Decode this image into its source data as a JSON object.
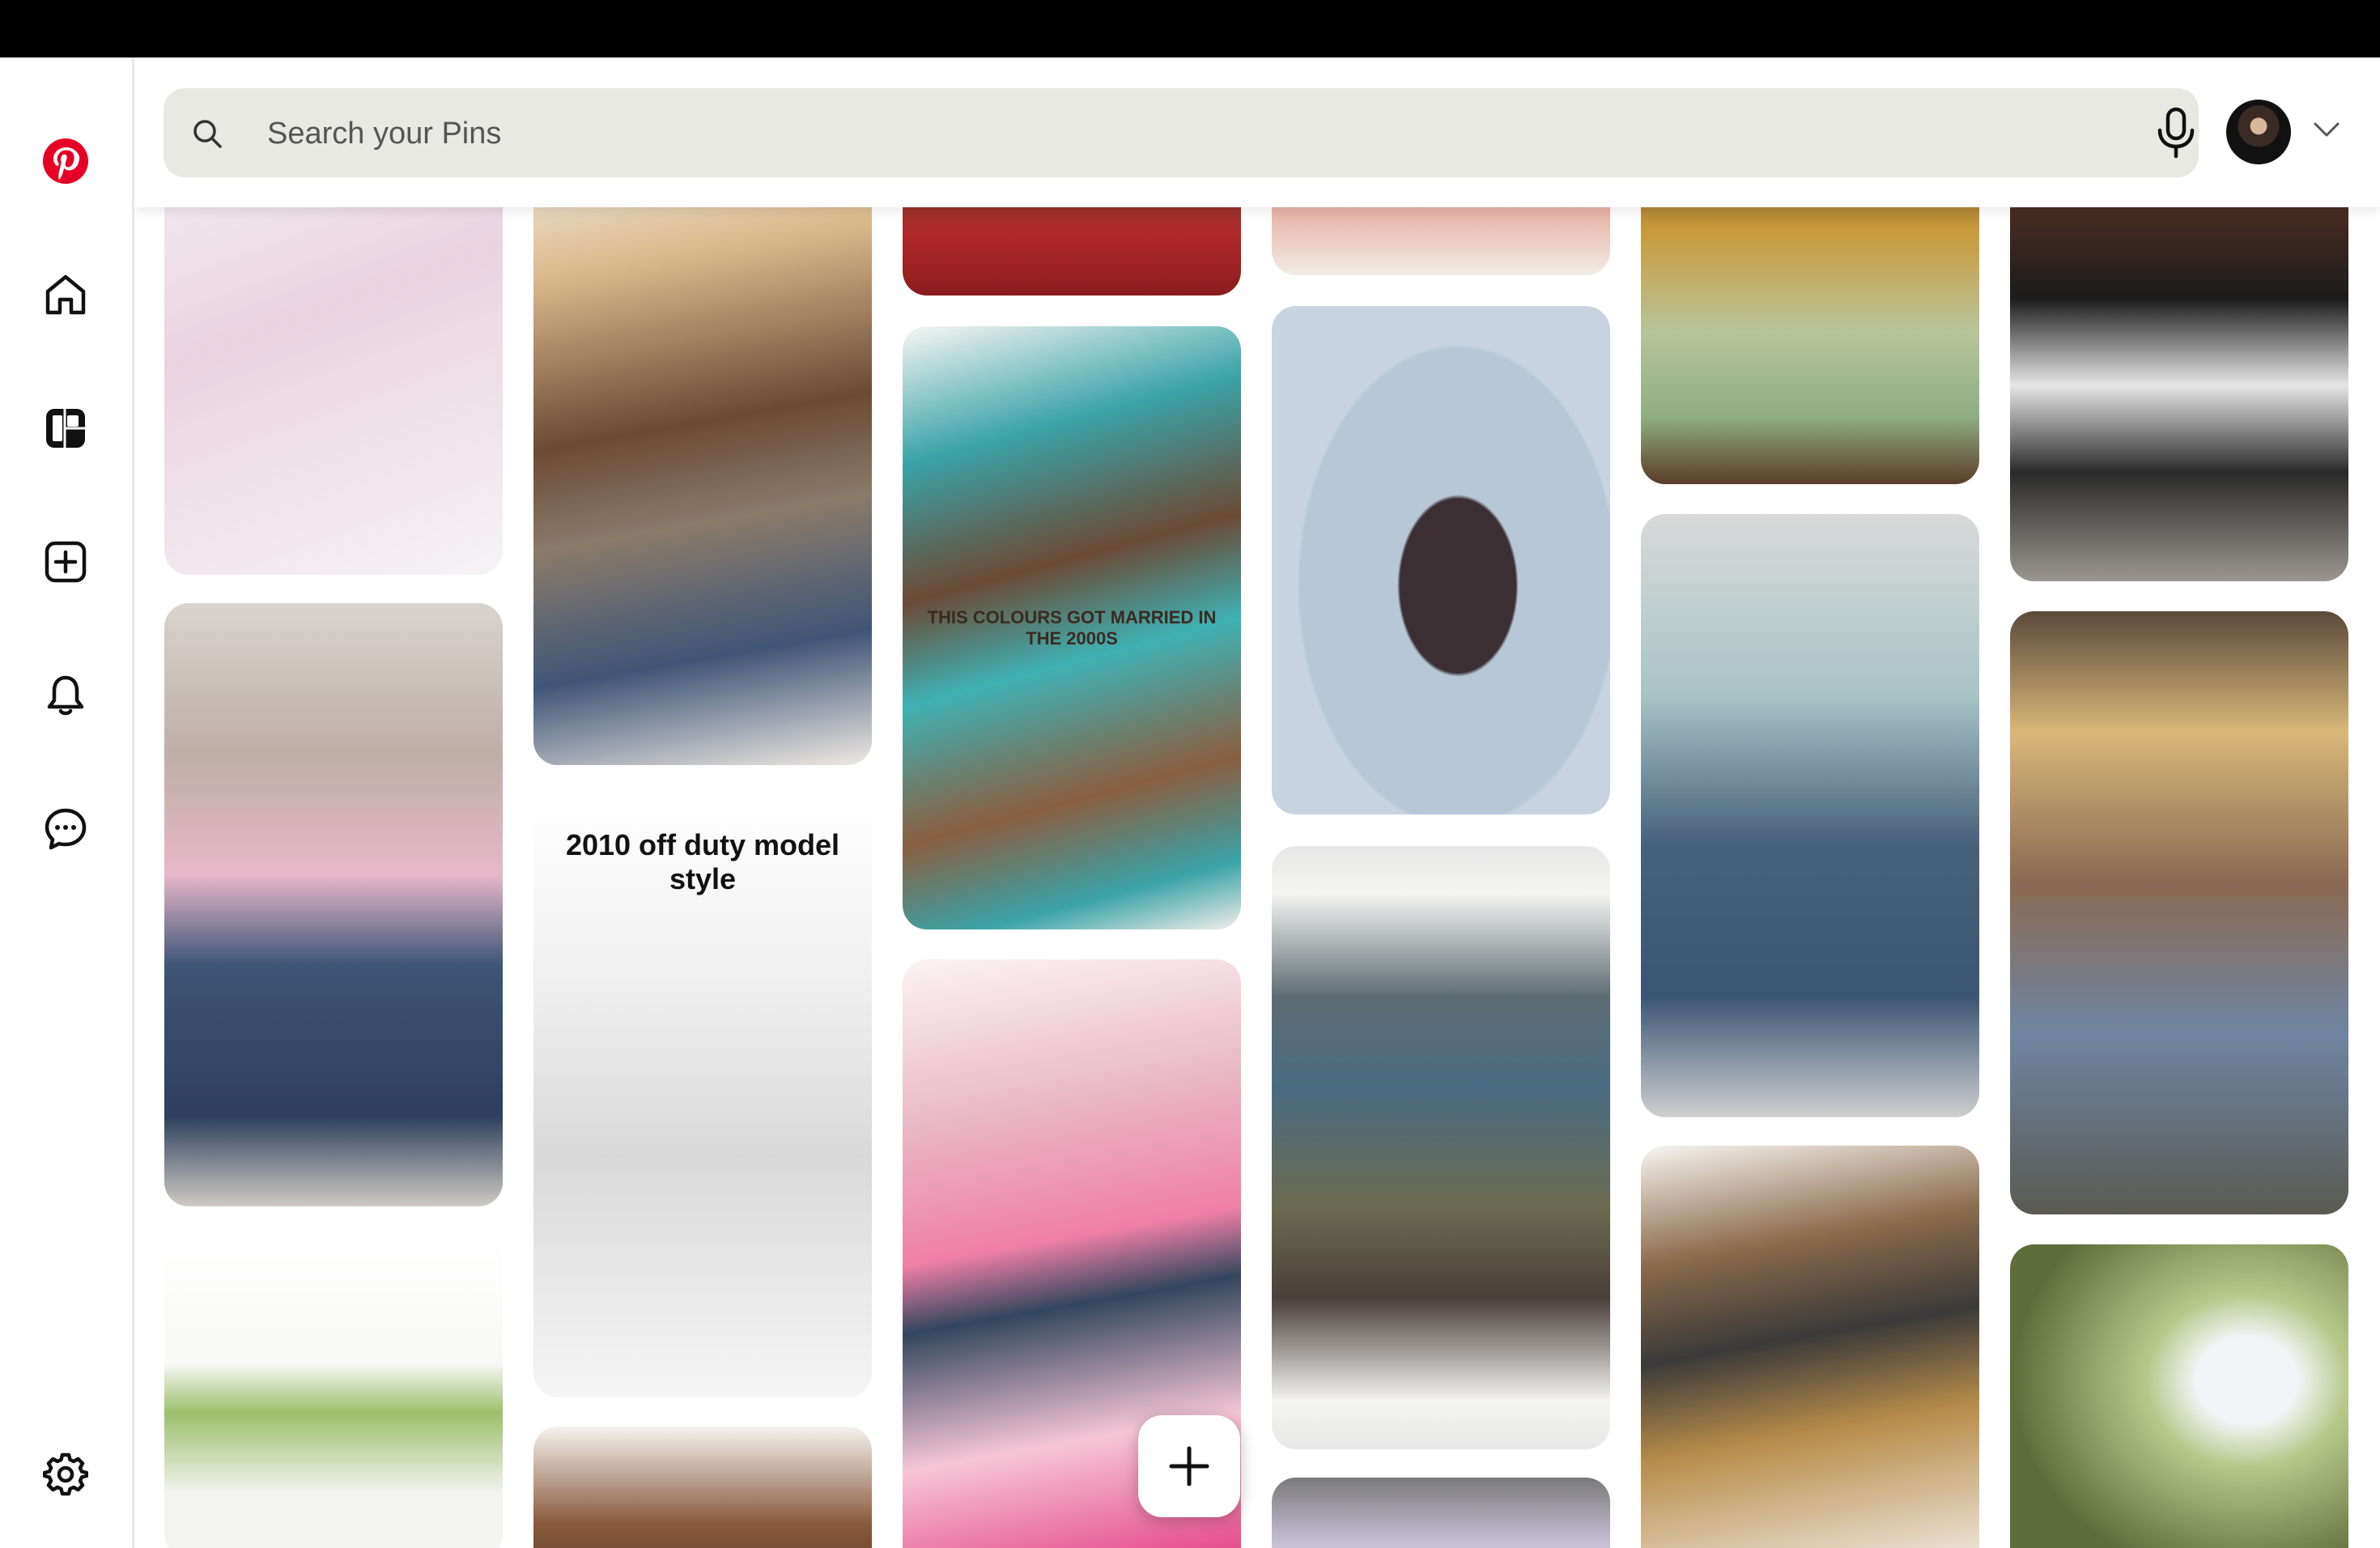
{
  "search": {
    "placeholder": "Search your Pins"
  },
  "sidebar": {
    "items": [
      {
        "name": "pinterest-logo",
        "icon": "pinterest-logo"
      },
      {
        "name": "home",
        "icon": "home-icon"
      },
      {
        "name": "boards",
        "icon": "boards-icon"
      },
      {
        "name": "create",
        "icon": "plus-square-icon"
      },
      {
        "name": "notifications",
        "icon": "bell-icon"
      },
      {
        "name": "messages",
        "icon": "chat-icon"
      },
      {
        "name": "settings",
        "icon": "gear-icon"
      }
    ]
  },
  "colors": {
    "brand": "#e60023",
    "search_bg": "#e9e9e4",
    "topbar": "#000000"
  },
  "pins": {
    "c1_2": {
      "text": ""
    },
    "c2_2": {
      "text": "2010 off duty model style"
    },
    "c3_2": {
      "text": "THIS COLOURS GOT MARRIED IN THE 2000S"
    }
  }
}
